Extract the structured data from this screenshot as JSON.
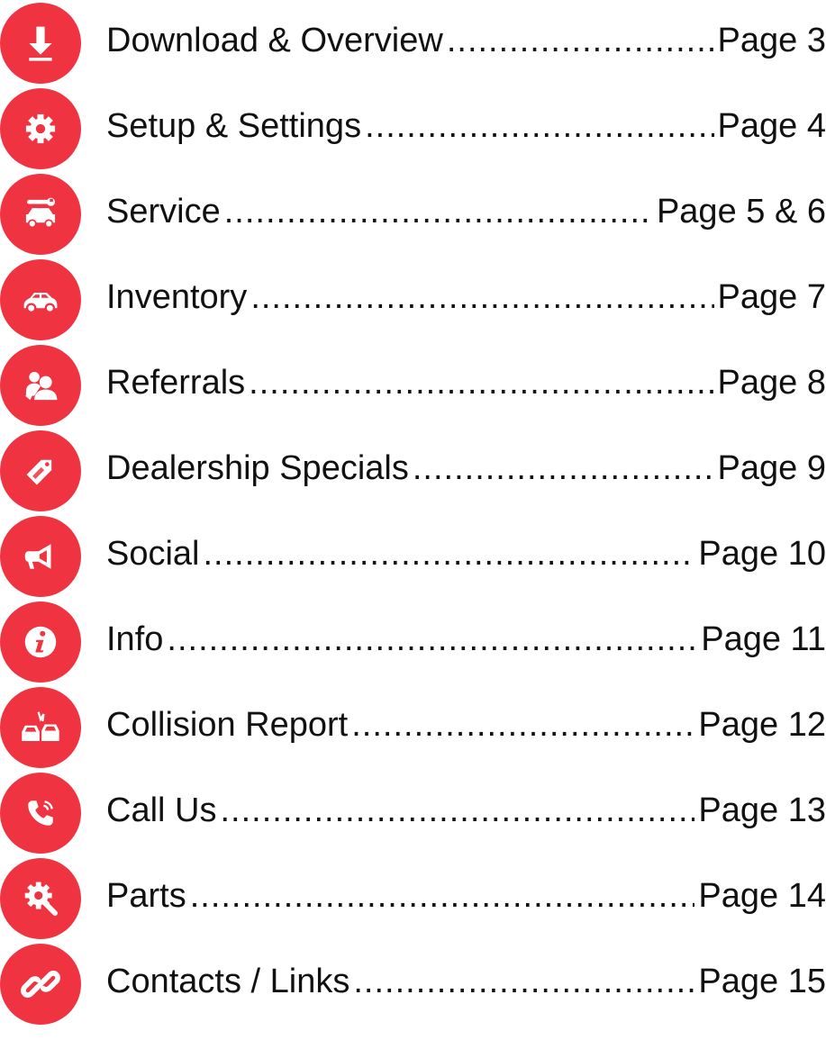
{
  "accent_color": "#ef3340",
  "entries": [
    {
      "title": "Download & Overview",
      "page": "Page 3",
      "icon": "download-icon"
    },
    {
      "title": "Setup & Settings",
      "page": "Page 4",
      "icon": "gear-icon"
    },
    {
      "title": "Service",
      "page": "Page 5 & 6",
      "icon": "car-service-icon"
    },
    {
      "title": "Inventory",
      "page": "Page 7",
      "icon": "car-icon"
    },
    {
      "title": "Referrals",
      "page": "Page 8",
      "icon": "referral-people-icon"
    },
    {
      "title": "Dealership Specials",
      "page": "Page 9",
      "icon": "deal-tag-icon"
    },
    {
      "title": "Social",
      "page": "Page 10",
      "icon": "megaphone-icon"
    },
    {
      "title": "Info",
      "page": "Page 11",
      "icon": "info-icon"
    },
    {
      "title": "Collision Report",
      "page": "Page 12",
      "icon": "collision-icon"
    },
    {
      "title": "Call Us",
      "page": "Page 13",
      "icon": "phone-icon"
    },
    {
      "title": "Parts",
      "page": "Page 14",
      "icon": "parts-wrench-icon"
    },
    {
      "title": "Contacts / Links",
      "page": "Page 15",
      "icon": "link-icon"
    }
  ]
}
